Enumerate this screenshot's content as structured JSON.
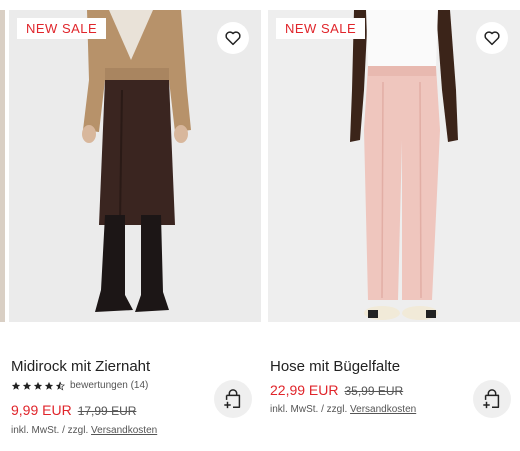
{
  "products": [
    {
      "badge": "NEW SALE",
      "title": "Midirock mit Ziernaht",
      "rating_stars": 4.5,
      "rating_text": "bewertungen (14)",
      "price_new": "9,99 EUR",
      "price_old": "17,99 EUR",
      "tax_text": "inkl. MwSt. / zzgl.",
      "shipping_link": "Versandkosten",
      "icons": [
        "heart-icon",
        "add-to-cart-icon"
      ]
    },
    {
      "badge": "NEW SALE",
      "title": "Hose mit Bügelfalte",
      "price_new": "22,99 EUR",
      "price_old": "35,99 EUR",
      "tax_text": "inkl. MwSt. / zzgl.",
      "shipping_link": "Versandkosten",
      "icons": [
        "heart-icon",
        "add-to-cart-icon"
      ]
    }
  ],
  "colors": {
    "sale": "#e0252b",
    "text": "#222222",
    "muted": "#555555"
  }
}
